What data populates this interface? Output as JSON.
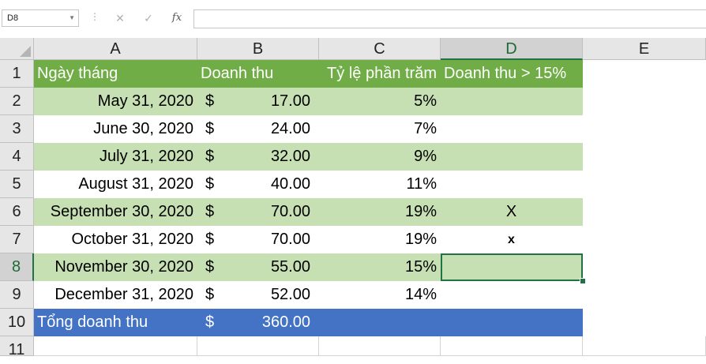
{
  "formula_bar": {
    "name_box": "D8",
    "cancel_icon": "✕",
    "enter_icon": "✓",
    "function_label": "fx",
    "formula": ""
  },
  "columns": [
    "A",
    "B",
    "C",
    "D",
    "E"
  ],
  "rows": [
    "1",
    "2",
    "3",
    "4",
    "5",
    "6",
    "7",
    "8",
    "9",
    "10",
    "11"
  ],
  "selected_cell": "D8",
  "colors": {
    "header_fill": "#70ad47",
    "band_fill": "#c6e0b4",
    "total_fill": "#4472c4",
    "selection": "#217346"
  },
  "table": {
    "headers": [
      "Ngày tháng",
      "Doanh thu",
      "Tỷ lệ phần trăm",
      "Doanh thu > 15%"
    ],
    "rows": [
      {
        "date": "May 31, 2020",
        "currency": "$",
        "amount": "17.00",
        "percent": "5%",
        "flag": ""
      },
      {
        "date": "June 30, 2020",
        "currency": "$",
        "amount": "24.00",
        "percent": "7%",
        "flag": ""
      },
      {
        "date": "July 31, 2020",
        "currency": "$",
        "amount": "32.00",
        "percent": "9%",
        "flag": ""
      },
      {
        "date": "August 31, 2020",
        "currency": "$",
        "amount": "40.00",
        "percent": "11%",
        "flag": ""
      },
      {
        "date": "September 30, 2020",
        "currency": "$",
        "amount": "70.00",
        "percent": "19%",
        "flag": "X"
      },
      {
        "date": "October 31, 2020",
        "currency": "$",
        "amount": "70.00",
        "percent": "19%",
        "flag": "x"
      },
      {
        "date": "November 30, 2020",
        "currency": "$",
        "amount": "55.00",
        "percent": "15%",
        "flag": ""
      },
      {
        "date": "December 31, 2020",
        "currency": "$",
        "amount": "52.00",
        "percent": "14%",
        "flag": ""
      }
    ],
    "total": {
      "label": "Tổng doanh thu",
      "currency": "$",
      "amount": "360.00"
    }
  }
}
